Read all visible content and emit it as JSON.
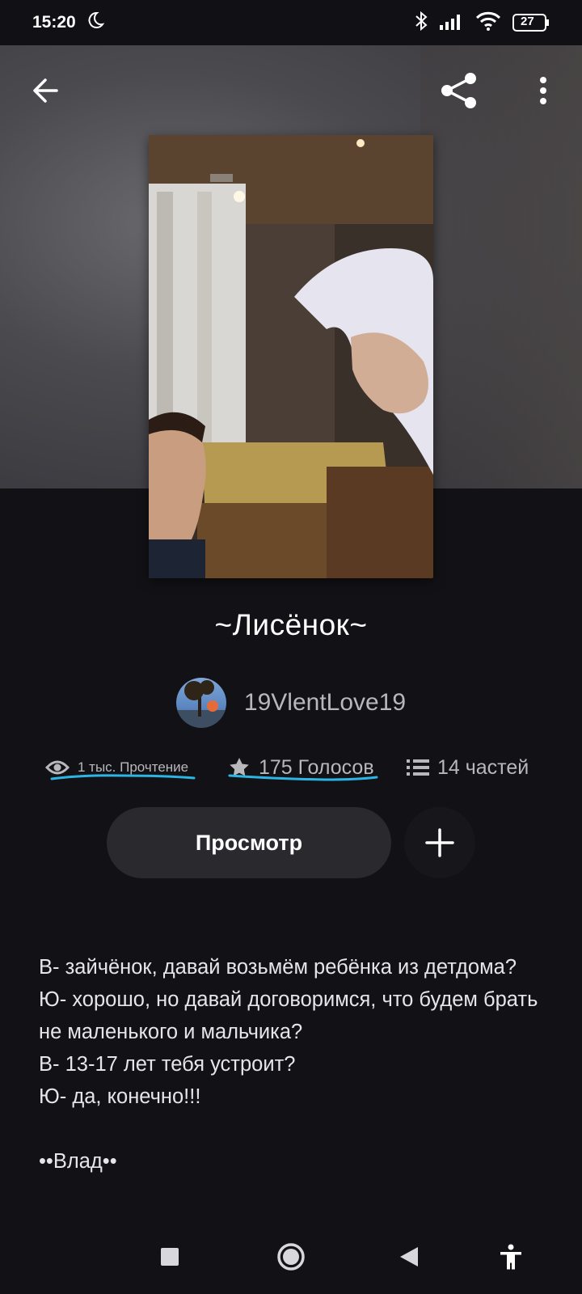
{
  "status": {
    "time": "15:20",
    "battery": "27"
  },
  "book": {
    "title": "~Лисёнок~",
    "author": "19VlentLove19",
    "reads": "1 тыс. Прочтение",
    "votes": "175 Голосов",
    "parts": "14 частей"
  },
  "actions": {
    "view_label": "Просмотр"
  },
  "description": [
    "В- зайчёнок, давай возьмём ребёнка из детдома?",
    "Ю- хорошо, но давай договоримся, что будем брать не маленького и мальчика?",
    "В- 13-17 лет тебя устроит?",
    "Ю- да, конечно!!!",
    "",
    "••Влад••"
  ],
  "annotation_color": "#2bb6e6"
}
